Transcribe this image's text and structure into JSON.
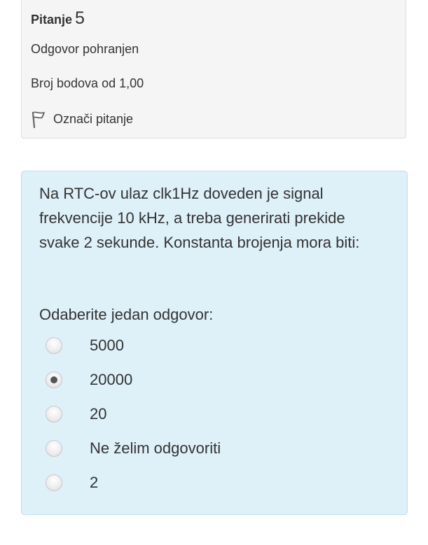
{
  "question_info": {
    "label": "Pitanje",
    "number": "5",
    "status": "Odgovor pohranjen",
    "points": "Broj bodova od 1,00",
    "flag_label": "Označi pitanje"
  },
  "question": {
    "text": "Na RTC-ov ulaz clk1Hz doveden je signal frekvencije 10 kHz, a treba generirati prekide svake 2 sekunde. Konstanta brojenja mora biti:",
    "prompt": "Odaberite jedan odgovor:",
    "options": [
      {
        "label": "5000",
        "selected": false
      },
      {
        "label": "20000",
        "selected": true
      },
      {
        "label": "20",
        "selected": false
      },
      {
        "label": "Ne želim odgovoriti",
        "selected": false
      },
      {
        "label": "2",
        "selected": false
      }
    ]
  },
  "icons": {
    "flag": "flag-icon",
    "radio": "radio-icon"
  },
  "colors": {
    "info_card_bg": "#f5f5f5",
    "question_card_bg": "#def0f8",
    "question_card_border": "#b9dff0",
    "text": "#333333"
  }
}
